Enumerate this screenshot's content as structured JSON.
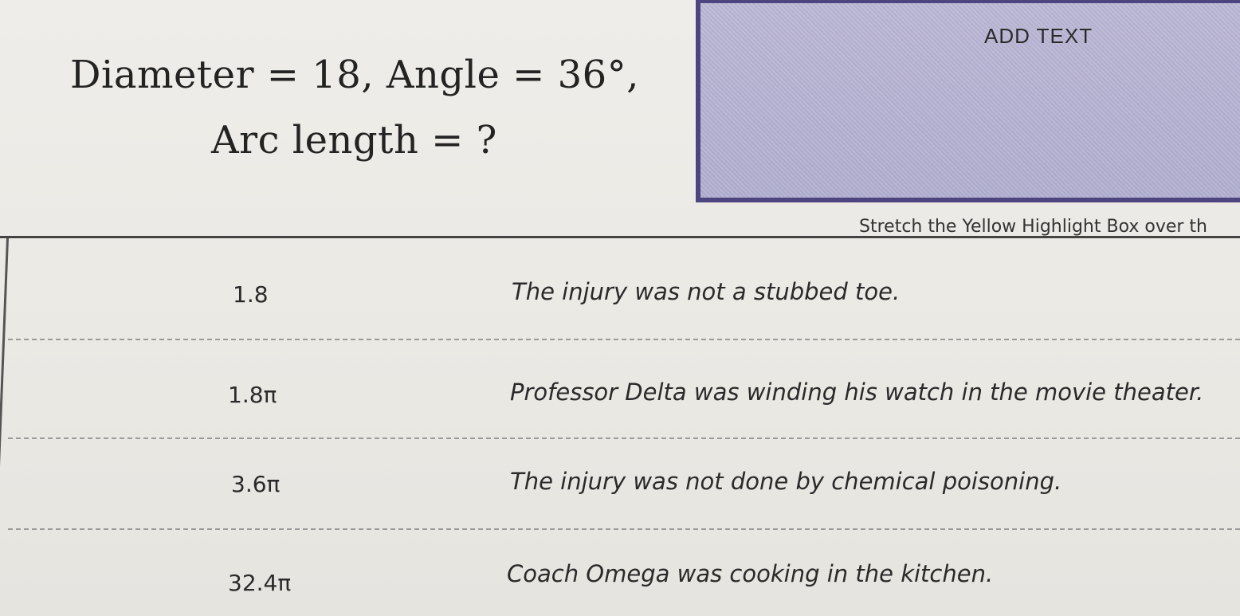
{
  "question": {
    "line1": "Diameter = 18, Angle = 36°,",
    "line2": "Arc length = ?"
  },
  "add_text_box": {
    "label": "ADD TEXT",
    "fill_color": "#b6b3d3",
    "border_color": "#4c4580"
  },
  "instruction": "Stretch the Yellow Highlight Box over th",
  "table": {
    "rows": [
      {
        "answer": "1.8",
        "clue": "The injury was not a stubbed toe."
      },
      {
        "answer": "1.8π",
        "clue": "Professor Delta was winding his watch in the movie theater."
      },
      {
        "answer": "3.6π",
        "clue": "The injury was not done by chemical poisoning."
      },
      {
        "answer": "32.4π",
        "clue": "Coach Omega was cooking in the kitchen."
      }
    ]
  }
}
